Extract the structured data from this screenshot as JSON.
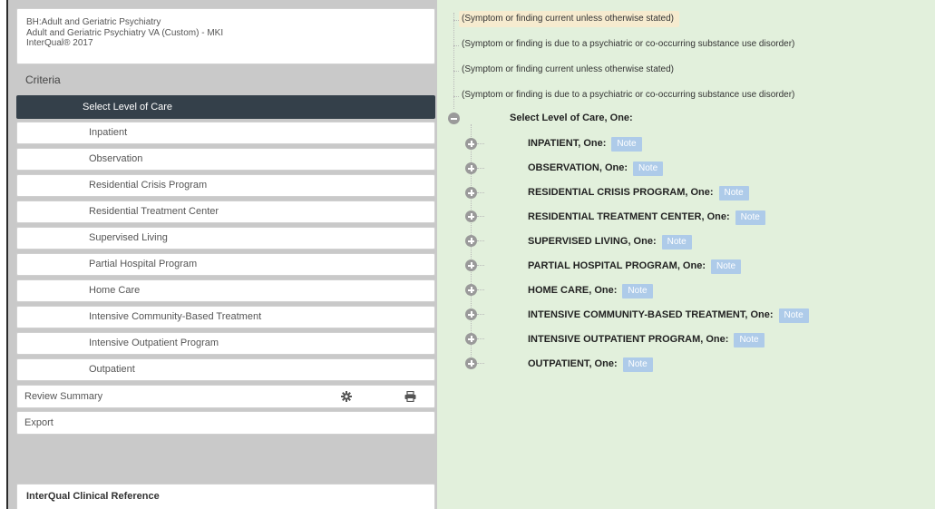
{
  "header": {
    "line1": "BH:Adult and Geriatric Psychiatry",
    "line2": "Adult and Geriatric Psychiatry VA (Custom) - MKI",
    "line3": "InterQual® 2017"
  },
  "sidebar": {
    "criteria_heading": "Criteria",
    "selected_item": "Select Level of Care",
    "levels": [
      {
        "label": "Inpatient"
      },
      {
        "label": "Observation"
      },
      {
        "label": "Residential Crisis Program"
      },
      {
        "label": "Residential Treatment Center"
      },
      {
        "label": "Supervised Living"
      },
      {
        "label": "Partial Hospital Program"
      },
      {
        "label": "Home Care"
      },
      {
        "label": "Intensive Community-Based Treatment"
      },
      {
        "label": "Intensive Outpatient Program"
      },
      {
        "label": "Outpatient"
      }
    ],
    "review_summary": "Review Summary",
    "export": "Export",
    "clinical_reference": "InterQual Clinical Reference"
  },
  "main": {
    "conditions": [
      "(Symptom or finding current unless otherwise stated)",
      "(Symptom or finding is due to a psychiatric or co-occurring substance use disorder)",
      "(Symptom or finding current unless otherwise stated)",
      "(Symptom or finding is due to a psychiatric or co-occurring substance use disorder)"
    ],
    "root_label": "Select Level of Care, One:",
    "note_label": "Note",
    "nodes": [
      {
        "name": "INPATIENT",
        "suffix": ", One:"
      },
      {
        "name": "OBSERVATION",
        "suffix": ", One:"
      },
      {
        "name": "RESIDENTIAL CRISIS PROGRAM",
        "suffix": ", One:"
      },
      {
        "name": "RESIDENTIAL TREATMENT CENTER",
        "suffix": ", One:"
      },
      {
        "name": "SUPERVISED LIVING",
        "suffix": ", One:"
      },
      {
        "name": "PARTIAL HOSPITAL PROGRAM",
        "suffix": ", One:"
      },
      {
        "name": "HOME CARE",
        "suffix": ", One:"
      },
      {
        "name": "INTENSIVE COMMUNITY-BASED TREATMENT",
        "suffix": ", One:"
      },
      {
        "name": "INTENSIVE OUTPATIENT PROGRAM",
        "suffix": ", One:"
      },
      {
        "name": "OUTPATIENT",
        "suffix": ", One:"
      }
    ]
  },
  "icons": {
    "settings": "gear-icon",
    "print": "printer-icon",
    "collapse": "minus-circle-icon",
    "expand": "plus-circle-icon"
  },
  "colors": {
    "selected_bg": "#34404a",
    "content_bg": "#e2f0dc",
    "note_bg": "#aecbe9",
    "highlight_bg": "#f6ebcf"
  }
}
